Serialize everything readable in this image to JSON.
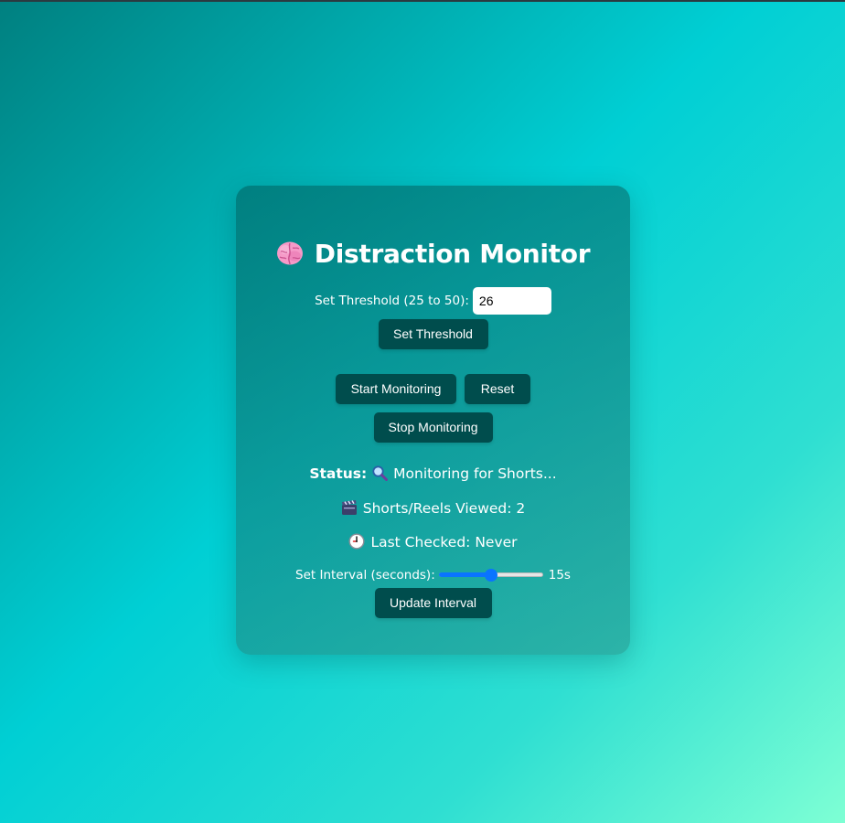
{
  "app": {
    "title": "Distraction Monitor",
    "title_icon": "brain-icon"
  },
  "threshold": {
    "label": "Set Threshold (25 to 50):",
    "value": "26",
    "button_label": "Set Threshold"
  },
  "controls": {
    "start_label": "Start Monitoring",
    "reset_label": "Reset",
    "stop_label": "Stop Monitoring"
  },
  "status": {
    "label": "Status:",
    "icon": "magnifier-icon",
    "text": "Monitoring for Shorts..."
  },
  "shorts": {
    "icon": "clapperboard-icon",
    "text": "Shorts/Reels Viewed: 2"
  },
  "last_checked": {
    "icon": "clock-icon",
    "text": "Last Checked: Never"
  },
  "interval": {
    "label": "Set Interval (seconds):",
    "value": 15,
    "min": 5,
    "max": 25,
    "value_text": "15s",
    "button_label": "Update Interval"
  },
  "colors": {
    "button_bg": "#004d4d",
    "slider_accent": "#0a74ff"
  }
}
